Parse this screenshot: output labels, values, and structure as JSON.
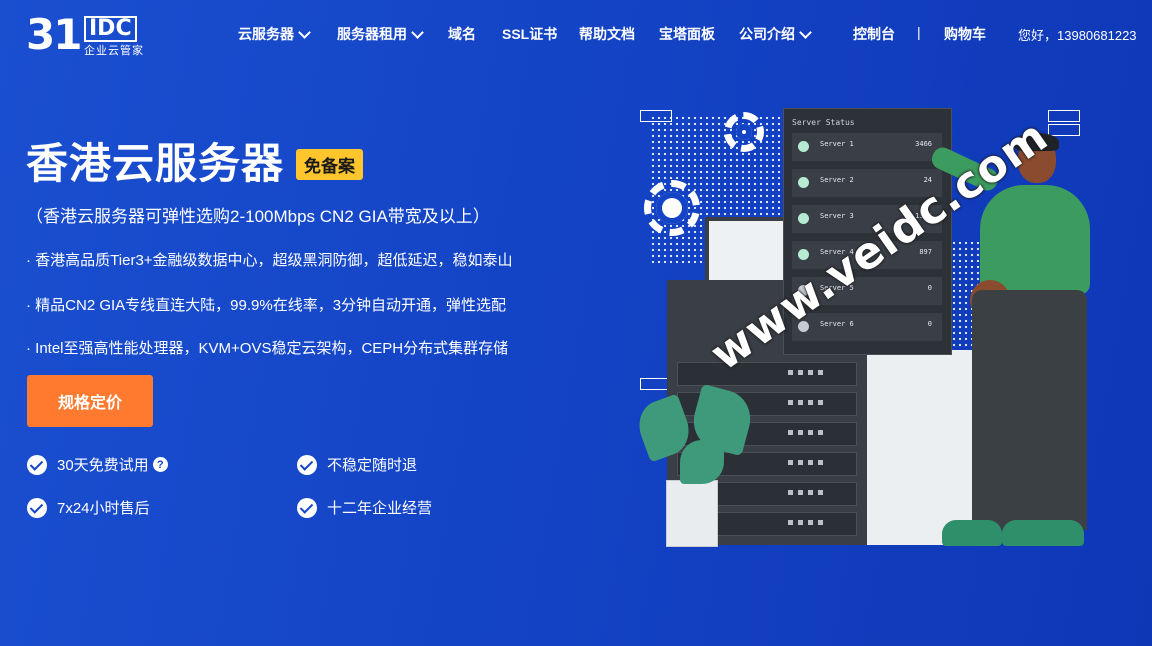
{
  "logo": {
    "number": "31",
    "idc": "IDC",
    "sub": "企业云管家"
  },
  "nav": {
    "items": [
      {
        "label": "云服务器",
        "dropdown": true
      },
      {
        "label": "服务器租用",
        "dropdown": true
      },
      {
        "label": "域名",
        "dropdown": false
      },
      {
        "label": "SSL证书",
        "dropdown": false
      },
      {
        "label": "帮助文档",
        "dropdown": false
      },
      {
        "label": "宝塔面板",
        "dropdown": false
      },
      {
        "label": "公司介绍",
        "dropdown": true
      }
    ],
    "console": "控制台",
    "separator": "|",
    "cart": "购物车",
    "greeting": "您好，13980681223"
  },
  "hero": {
    "title": "香港云服务器",
    "badge": "免备案",
    "subtitle": "（香港云服务器可弹性选购2-100Mbps CN2 GIA带宽及以上）",
    "features": [
      "· 香港高品质Tier3+金融级数据中心，超级黑洞防御，超低延迟，稳如泰山",
      "· 精品CN2 GIA专线直连大陆，99.9%在线率，3分钟自动开通，弹性选配",
      "· Intel至强高性能处理器，KVM+OVS稳定云架构，CEPH分布式集群存储"
    ],
    "cta": "规格定价",
    "checks": [
      "30天免费试用",
      "不稳定随时退",
      "7x24小时售后",
      "十二年企业经营"
    ],
    "help_glyph": "?"
  },
  "server_status": {
    "title": "Server Status",
    "rows": [
      {
        "name": "Server 1",
        "value": "3466",
        "ok": true
      },
      {
        "name": "Server 2",
        "value": "24",
        "ok": true
      },
      {
        "name": "Server 3",
        "value": "1346",
        "ok": true
      },
      {
        "name": "Server 4",
        "value": "897",
        "ok": true
      },
      {
        "name": "Server 5",
        "value": "0",
        "ok": false
      },
      {
        "name": "Server 6",
        "value": "0",
        "ok": false
      }
    ]
  },
  "watermark": "www.veidc.com"
}
